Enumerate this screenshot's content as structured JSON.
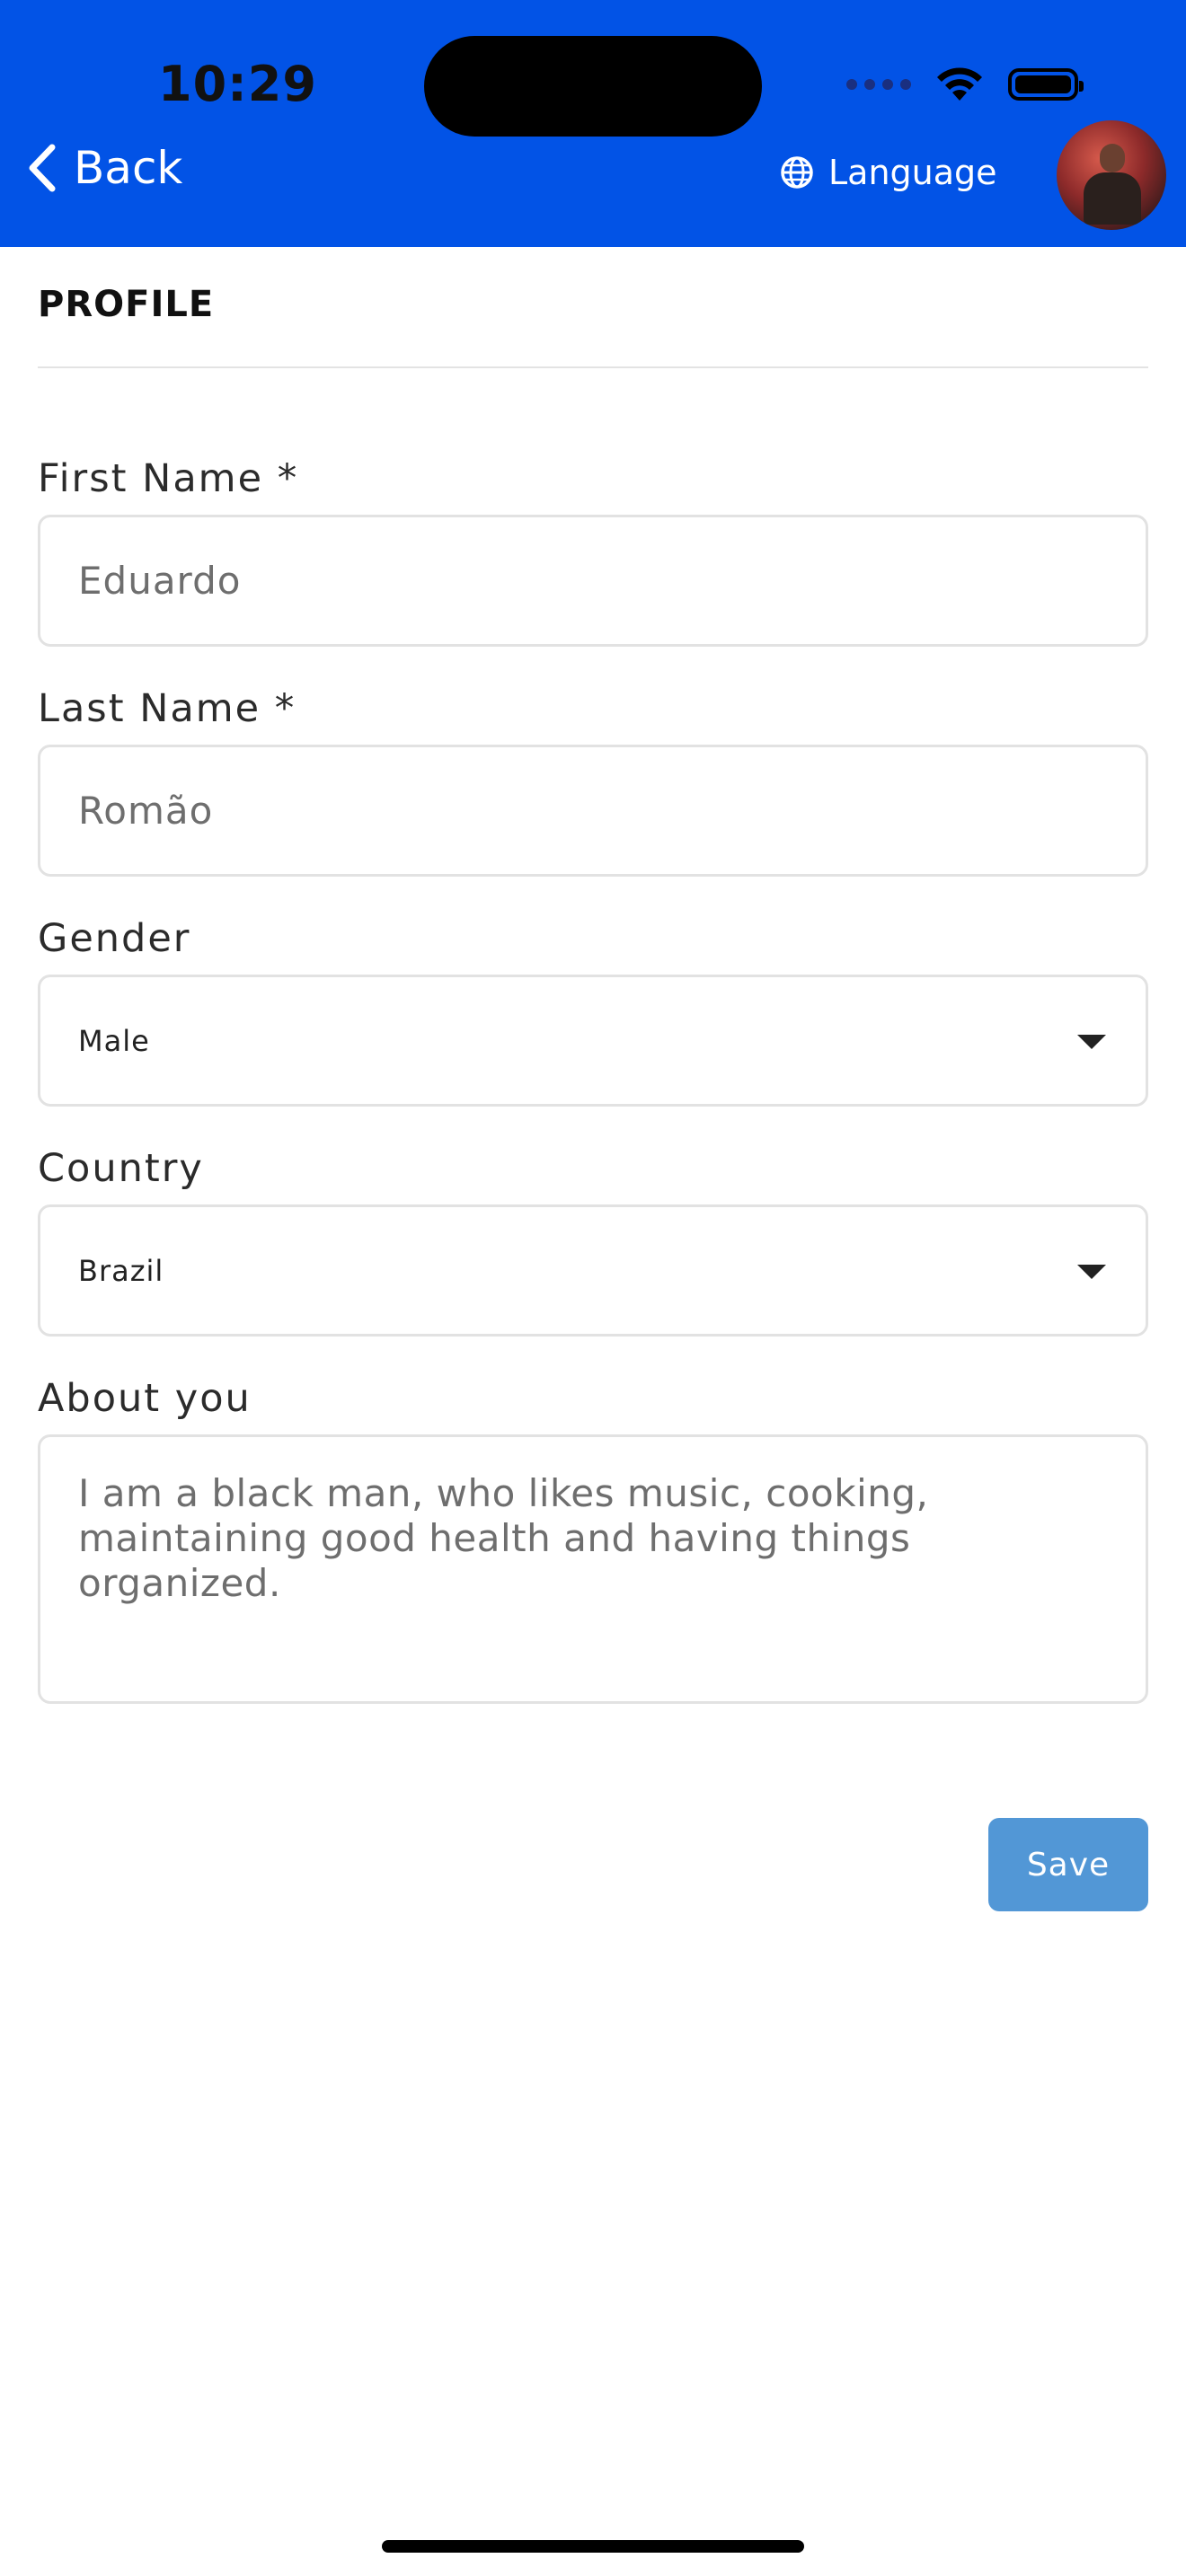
{
  "status_bar": {
    "time": "10:29"
  },
  "nav": {
    "back_label": "Back",
    "language_label": "Language"
  },
  "profile": {
    "section_title": "PROFILE",
    "first_name": {
      "label": "First Name *",
      "value": "Eduardo"
    },
    "last_name": {
      "label": "Last Name *",
      "value": "Romão"
    },
    "gender": {
      "label": "Gender",
      "value": "Male"
    },
    "country": {
      "label": "Country",
      "value": "Brazil"
    },
    "about": {
      "label": "About you",
      "value": "I am a black man, who likes music, cooking, maintaining good health and having things organized."
    },
    "save_label": "Save"
  },
  "colors": {
    "header": "#0253e6",
    "save_button": "#5297d6",
    "field_border": "#e2e2e2"
  },
  "icons": [
    "chevron-left-icon",
    "globe-icon",
    "wifi-icon",
    "battery-icon",
    "caret-down-icon"
  ]
}
